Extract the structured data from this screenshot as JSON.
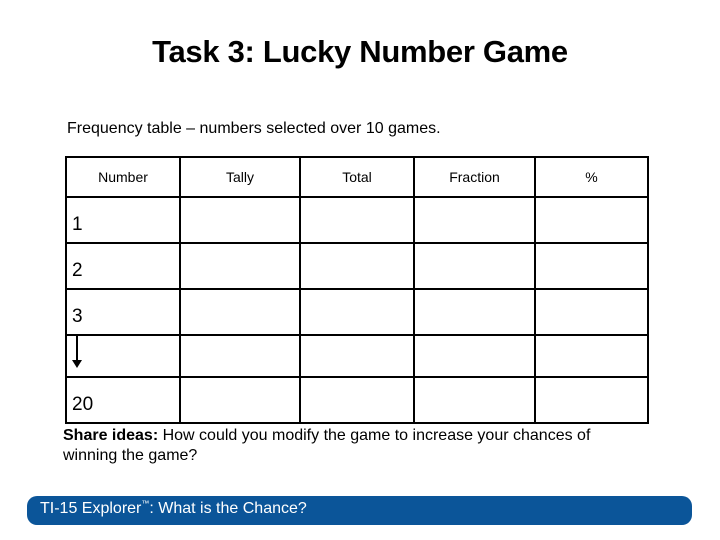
{
  "title": "Task 3: Lucky Number Game",
  "subtitle": "Frequency table – numbers selected over 10 games.",
  "table": {
    "headers": [
      "Number",
      "Tally",
      "Total",
      "Fraction",
      "%"
    ],
    "rows": [
      {
        "number": "1",
        "tally": "",
        "total": "",
        "fraction": "",
        "percent": ""
      },
      {
        "number": "2",
        "tally": "",
        "total": "",
        "fraction": "",
        "percent": ""
      },
      {
        "number": "3",
        "tally": "",
        "total": "",
        "fraction": "",
        "percent": ""
      },
      {
        "number": "",
        "icon": "down-arrow-icon",
        "tally": "",
        "total": "",
        "fraction": "",
        "percent": ""
      },
      {
        "number": "20",
        "tally": "",
        "total": "",
        "fraction": "",
        "percent": ""
      }
    ]
  },
  "share": {
    "label": "Share ideas:",
    "text": " How could you modify the game to increase your chances of winning the game?"
  },
  "footer": {
    "text": "TI-15 Explorer",
    "trademark": "™",
    "suffix": ": What is the Chance?",
    "color": "#0b5599"
  }
}
